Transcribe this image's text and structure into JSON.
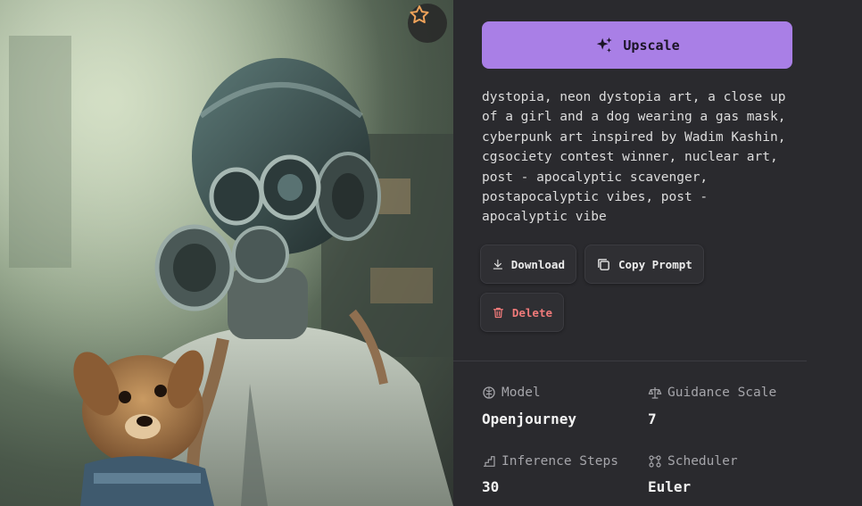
{
  "image": {
    "favorite_icon": "star-icon",
    "accent": "#f0a35a"
  },
  "actions": {
    "upscale_label": "Upscale",
    "download_label": "Download",
    "copy_label": "Copy Prompt",
    "delete_label": "Delete"
  },
  "prompt": "dystopia, neon dystopia art, a close up\nof a girl and a dog wearing a gas mask,\ncyberpunk art inspired by Wadim Kashin,\ncgsociety contest winner, nuclear art,\npost - apocalyptic scavenger,\npostapocalyptic vibes, post -\napocalyptic vibe",
  "meta": {
    "model_label": "Model",
    "model_value": "Openjourney",
    "guidance_label": "Guidance Scale",
    "guidance_value": "7",
    "steps_label": "Inference Steps",
    "steps_value": "30",
    "scheduler_label": "Scheduler",
    "scheduler_value": "Euler"
  },
  "colors": {
    "accent": "#a97fe6",
    "danger": "#f07a7a",
    "panel": "#2a2a2e"
  }
}
